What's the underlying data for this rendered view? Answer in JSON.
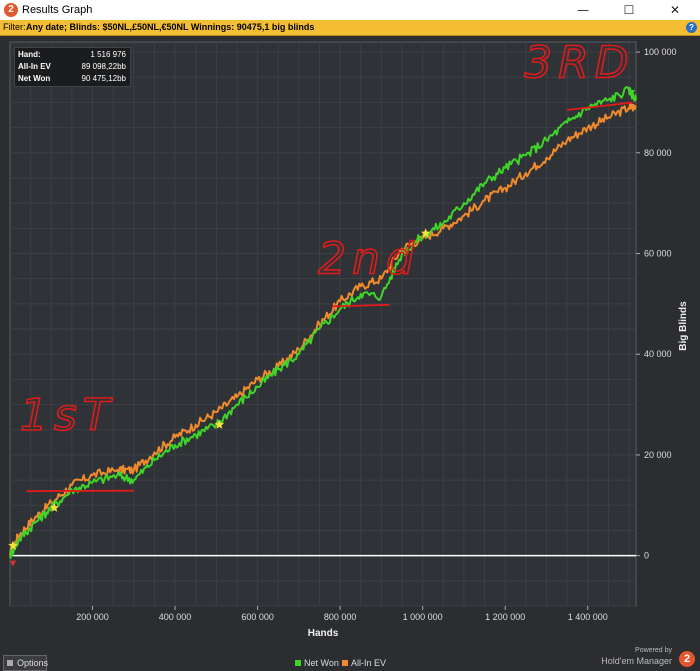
{
  "window": {
    "title": "Results Graph",
    "app_icon": "2",
    "minimize_icon": "minimize-icon",
    "maximize_icon": "maximize-icon",
    "close_icon": "close-icon"
  },
  "filter": {
    "prefix": "Filter:",
    "text": "Any date; Blinds: $50NL,£50NL,€50NL Winnings: 90475,1 big blinds",
    "help_icon": "?"
  },
  "info": {
    "rows": [
      {
        "label": "Hand:",
        "value": "1 516 976"
      },
      {
        "label": "All-In EV",
        "value": "89 098,22bb"
      },
      {
        "label": "Net Won",
        "value": "90 475,12bb"
      }
    ]
  },
  "bottom": {
    "options_label": "Options",
    "legend": [
      {
        "label": "Net Won",
        "color": "#3fd42a"
      },
      {
        "label": "All-In EV",
        "color": "#f08a2c"
      }
    ],
    "powered_by": "Powered by",
    "product": "Hold'em Manager",
    "logo": "2"
  },
  "chart_data": {
    "type": "line",
    "xlabel": "Hands",
    "ylabel": "Big Blinds",
    "xlim": [
      0,
      1516976
    ],
    "ylim": [
      -10000,
      102000
    ],
    "xticks": [
      200000,
      400000,
      600000,
      800000,
      1000000,
      1200000,
      1400000
    ],
    "xtick_labels": [
      "200 000",
      "400 000",
      "600 000",
      "800 000",
      "1 000 000",
      "1 200 000",
      "1 400 000"
    ],
    "yticks": [
      0,
      20000,
      40000,
      60000,
      80000,
      100000
    ],
    "ytick_labels": [
      "0",
      "20 000",
      "40 000",
      "60 000",
      "80 000",
      "100 000"
    ],
    "grid": true,
    "legend_position": "bottom-center",
    "series": [
      {
        "name": "Net Won",
        "color": "#3fd42a",
        "x": [
          0,
          20000,
          60000,
          100000,
          150000,
          200000,
          260000,
          300000,
          350000,
          400000,
          450000,
          500000,
          550000,
          600000,
          650000,
          700000,
          750000,
          800000,
          850000,
          900000,
          950000,
          1000000,
          1050000,
          1100000,
          1150000,
          1200000,
          1250000,
          1300000,
          1350000,
          1400000,
          1450000,
          1500000,
          1516976
        ],
        "y": [
          0,
          3000,
          6500,
          9500,
          13000,
          14500,
          16000,
          15000,
          19000,
          22000,
          24000,
          26000,
          30000,
          33500,
          37000,
          40000,
          45000,
          49000,
          52000,
          51500,
          60000,
          63500,
          66000,
          70000,
          74000,
          77000,
          79500,
          82500,
          86000,
          89000,
          90500,
          92500,
          90475
        ]
      },
      {
        "name": "All-In EV",
        "color": "#f08a2c",
        "x": [
          0,
          20000,
          60000,
          100000,
          150000,
          200000,
          260000,
          300000,
          350000,
          400000,
          450000,
          500000,
          550000,
          600000,
          650000,
          700000,
          750000,
          800000,
          850000,
          900000,
          950000,
          1000000,
          1050000,
          1100000,
          1150000,
          1200000,
          1250000,
          1300000,
          1350000,
          1400000,
          1450000,
          1500000,
          1516976
        ],
        "y": [
          0,
          4000,
          7500,
          10500,
          14000,
          16000,
          17000,
          17000,
          20500,
          23500,
          26000,
          28500,
          31500,
          35000,
          37500,
          41000,
          46000,
          50500,
          53500,
          55000,
          61000,
          63000,
          65000,
          67500,
          70500,
          73000,
          76000,
          79000,
          82500,
          85000,
          87000,
          89000,
          89098
        ]
      }
    ],
    "markers": [
      {
        "x": 0,
        "y": 2000,
        "color": "#f2e23a"
      },
      {
        "x": 100000,
        "y": 9500,
        "color": "#f2e23a"
      },
      {
        "x": 500000,
        "y": 26000,
        "color": "#f2e23a"
      },
      {
        "x": 1000000,
        "y": 64000,
        "color": "#f2e23a"
      },
      {
        "x": 0,
        "y": -1000,
        "color": "#e03030"
      },
      {
        "x": 1500000,
        "y": 92500,
        "color": "#3fd42a"
      }
    ],
    "annotations": [
      {
        "text": "1sT",
        "x": 140000,
        "y": 25000,
        "color": "#e01b1b"
      },
      {
        "text": "2nd",
        "x": 870000,
        "y": 56000,
        "color": "#e01b1b"
      },
      {
        "text": "3RD",
        "x": 1380000,
        "y": 95000,
        "color": "#e01b1b"
      }
    ]
  }
}
